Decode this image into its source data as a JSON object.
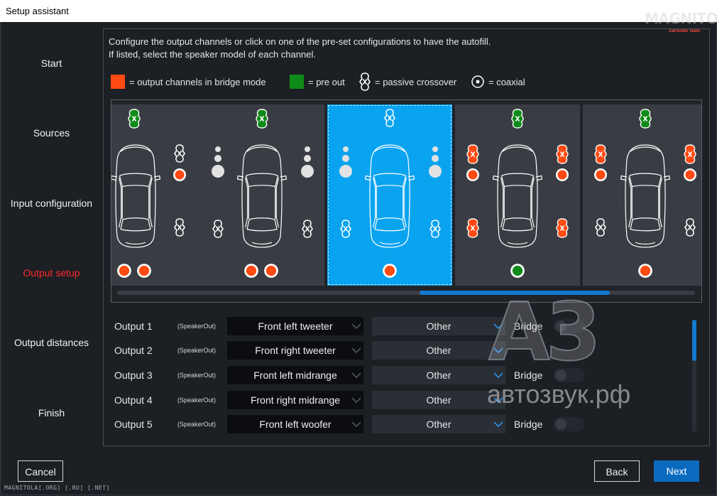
{
  "window": {
    "title": "Setup assistant"
  },
  "logo": {
    "text": "MAGNITOLA",
    "tagline": "CarAudio Team"
  },
  "steps": [
    {
      "label": "Start",
      "active": false
    },
    {
      "label": "Sources",
      "active": false
    },
    {
      "label": "Input configuration",
      "active": false
    },
    {
      "label": "Output setup",
      "active": true
    },
    {
      "label": "Output distances",
      "active": false
    },
    {
      "label": "Finish",
      "active": false
    }
  ],
  "intro": {
    "line1": "Configure the output channels or click on one of the pre-set configurations to have the autofill.",
    "line2": "If listed, select the speaker model of each channel."
  },
  "legend": {
    "bridge_label": "= output channels in bridge mode",
    "preout_label": "= pre out",
    "crossover_label": "= passive crossover",
    "coaxial_label": "= coaxial"
  },
  "colors": {
    "bridge": "#ff4a12",
    "preout": "#0e8a18",
    "selected": "#0aa3f0",
    "accent": "#0a6ac0",
    "active_step": "#ff2a2a"
  },
  "presets": {
    "selected_index": 2,
    "count_visible": 5
  },
  "outputs": [
    {
      "label": "Output 1",
      "sub": "(SpeakerOut)",
      "channel": "Front left tweeter",
      "model": "Other",
      "bridge_label": "Bridge"
    },
    {
      "label": "Output 2",
      "sub": "(SpeakerOut)",
      "channel": "Front right tweeter",
      "model": "Other",
      "bridge_label": ""
    },
    {
      "label": "Output 3",
      "sub": "(SpeakerOut)",
      "channel": "Front left midrange",
      "model": "Other",
      "bridge_label": "Bridge"
    },
    {
      "label": "Output 4",
      "sub": "(SpeakerOut)",
      "channel": "Front right midrange",
      "model": "Other",
      "bridge_label": ""
    },
    {
      "label": "Output 5",
      "sub": "(SpeakerOut)",
      "channel": "Front left woofer",
      "model": "Other",
      "bridge_label": "Bridge"
    }
  ],
  "watermark": {
    "big": "A3",
    "text": "автозвук.рф"
  },
  "buttons": {
    "cancel": "Cancel",
    "back": "Back",
    "next": "Next"
  },
  "footer": {
    "text": "MAGNITOLA[.ORG] [.RU] [.NET]"
  }
}
